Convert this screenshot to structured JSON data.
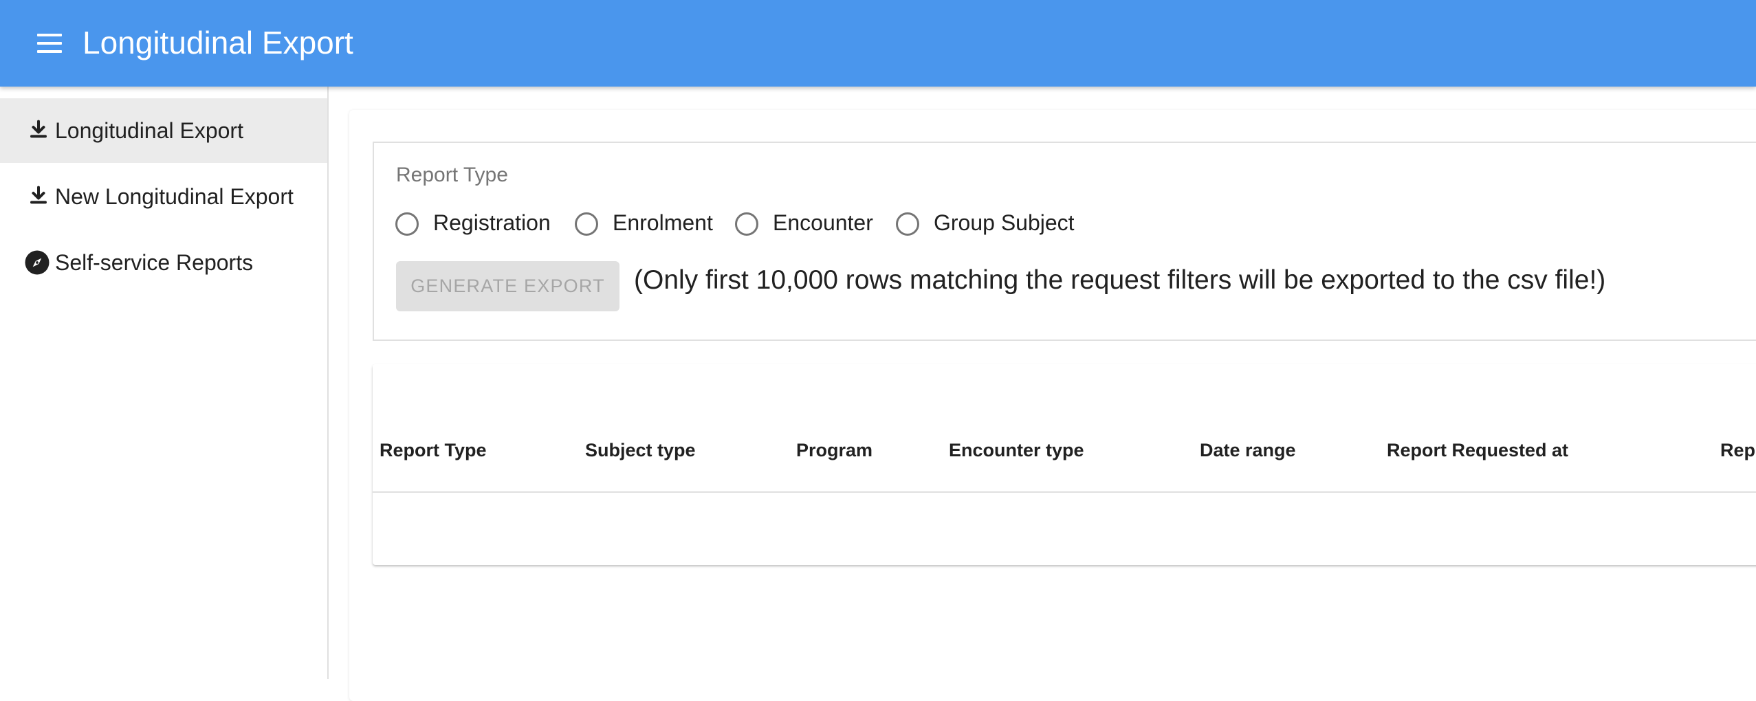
{
  "header": {
    "title": "Longitudinal Export",
    "menu_icon": "menu-icon"
  },
  "sidebar": {
    "items": [
      {
        "label": "Longitudinal Export",
        "icon": "download-icon",
        "active": true
      },
      {
        "label": "New Longitudinal Export",
        "icon": "download-icon",
        "active": false
      },
      {
        "label": "Self-service Reports",
        "icon": "compass-icon",
        "active": false
      }
    ]
  },
  "form": {
    "report_type_label": "Report Type",
    "options": [
      "Registration",
      "Enrolment",
      "Encounter",
      "Group Subject"
    ],
    "selected": null,
    "generate_button": "GENERATE EXPORT",
    "note": "(Only first 10,000 rows matching the request filters will be exported to the csv file!)"
  },
  "table": {
    "columns": [
      "Report Type",
      "Subject type",
      "Program",
      "Encounter type",
      "Date range",
      "Report Requested at",
      "Repo"
    ],
    "rows": []
  },
  "colors": {
    "appbar": "#4a96ed",
    "active_nav": "#ebebeb",
    "button_disabled_bg": "#e0e0e0",
    "button_disabled_text": "#a6a6a6"
  }
}
